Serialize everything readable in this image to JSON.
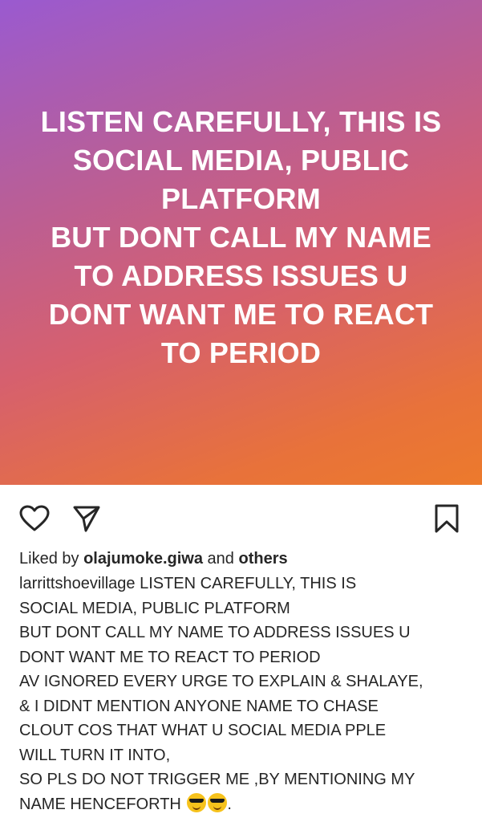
{
  "post": {
    "image_text": "LISTEN CAREFULLY, THIS IS\nSOCIAL MEDIA, PUBLIC\nPLATFORM\nBUT DONT CALL MY NAME\nTO ADDRESS ISSUES U\nDONT WANT ME TO REACT\nTO PERIOD",
    "gradient_colors": [
      "#9a5ad0",
      "#d6606e",
      "#ec7a2c"
    ]
  },
  "actions": {
    "like_icon": "heart-icon",
    "share_icon": "send-icon",
    "save_icon": "bookmark-icon"
  },
  "likes": {
    "prefix": "Liked by ",
    "user": "olajumoke.giwa",
    "middle": " and ",
    "others": "others"
  },
  "caption": {
    "username": "larrittshoevillage",
    "text": " LISTEN CAREFULLY, THIS IS\nSOCIAL MEDIA, PUBLIC PLATFORM\nBUT DONT CALL MY NAME TO ADDRESS ISSUES U\nDONT WANT ME TO REACT TO PERIOD\nAV IGNORED EVERY URGE TO EXPLAIN & SHALAYE,\n& I DIDNT MENTION ANYONE NAME TO CHASE\nCLOUT COS THAT WHAT U SOCIAL MEDIA PPLE\nWILL TURN IT INTO,\nSO PLS DO NOT TRIGGER ME ,BY MENTIONING MY\nNAME HENCEFORTH ",
    "trailing": ".",
    "emoji_name": "smiling-face-with-sunglasses"
  }
}
